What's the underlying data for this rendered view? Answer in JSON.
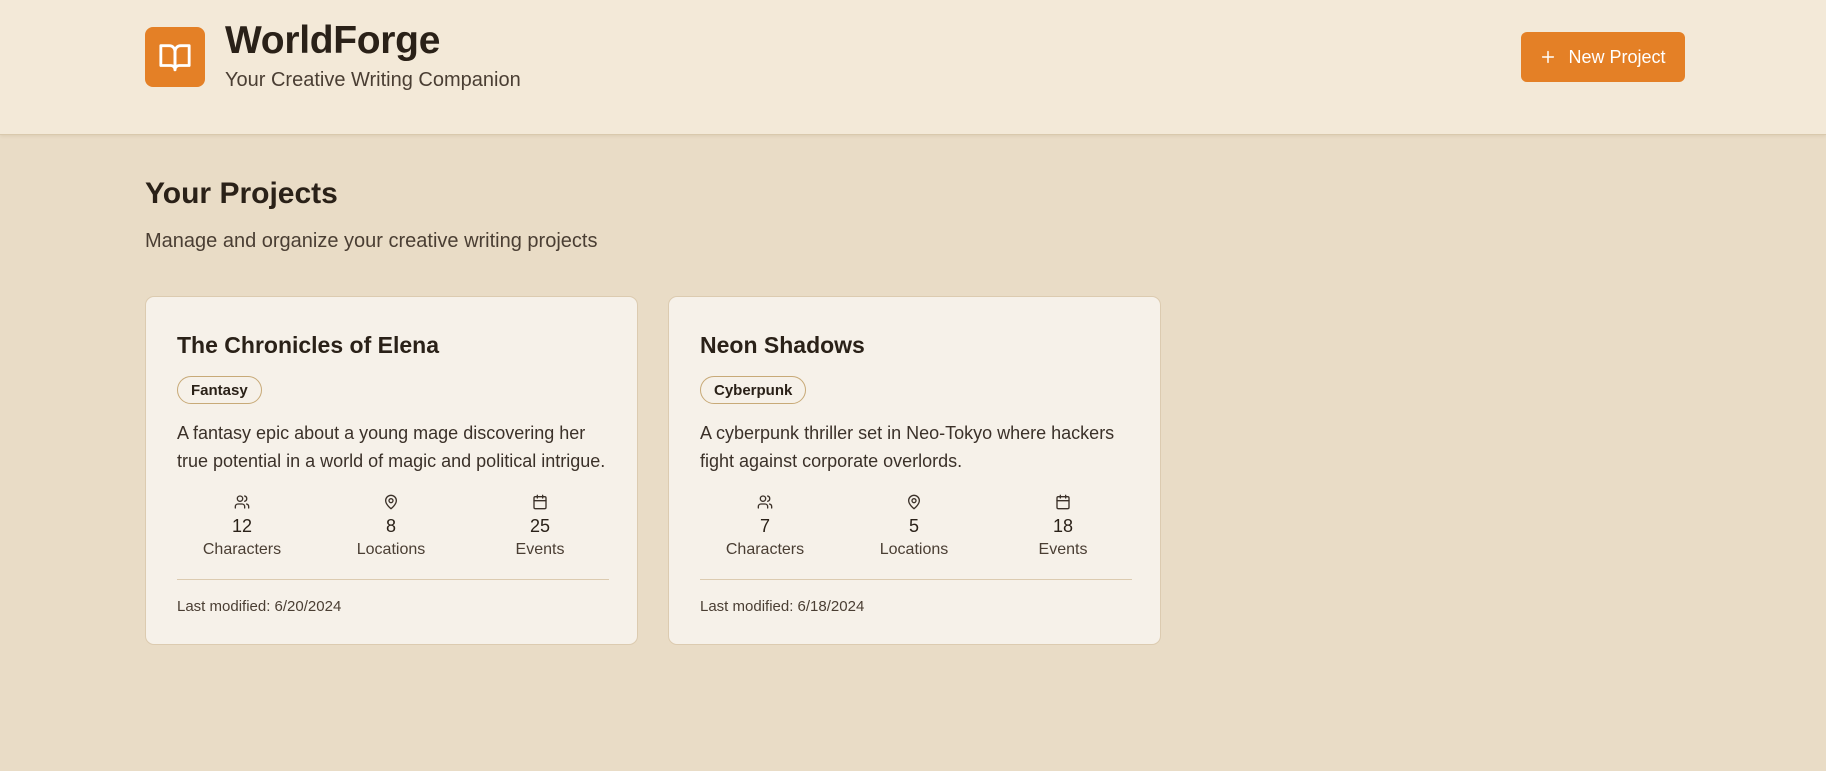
{
  "header": {
    "logo_icon": "book-open-icon",
    "title": "WorldForge",
    "subtitle": "Your Creative Writing Companion",
    "new_project_label": "New Project",
    "new_project_icon": "plus-icon",
    "accent_color": "#e48026"
  },
  "main": {
    "title": "Your Projects",
    "subtitle": "Manage and organize your creative writing projects"
  },
  "projects": [
    {
      "title": "The Chronicles of Elena",
      "genre": "Fantasy",
      "description": "A fantasy epic about a young mage discovering her true potential in a world of magic and political intrigue.",
      "stats": [
        {
          "icon": "users-icon",
          "value": "12",
          "label": "Characters"
        },
        {
          "icon": "map-pin-icon",
          "value": "8",
          "label": "Locations"
        },
        {
          "icon": "calendar-icon",
          "value": "25",
          "label": "Events"
        }
      ],
      "last_modified": "Last modified: 6/20/2024"
    },
    {
      "title": "Neon Shadows",
      "genre": "Cyberpunk",
      "description": "A cyberpunk thriller set in Neo-Tokyo where hackers fight against corporate overlords.",
      "stats": [
        {
          "icon": "users-icon",
          "value": "7",
          "label": "Characters"
        },
        {
          "icon": "map-pin-icon",
          "value": "5",
          "label": "Locations"
        },
        {
          "icon": "calendar-icon",
          "value": "18",
          "label": "Events"
        }
      ],
      "last_modified": "Last modified: 6/18/2024"
    }
  ]
}
